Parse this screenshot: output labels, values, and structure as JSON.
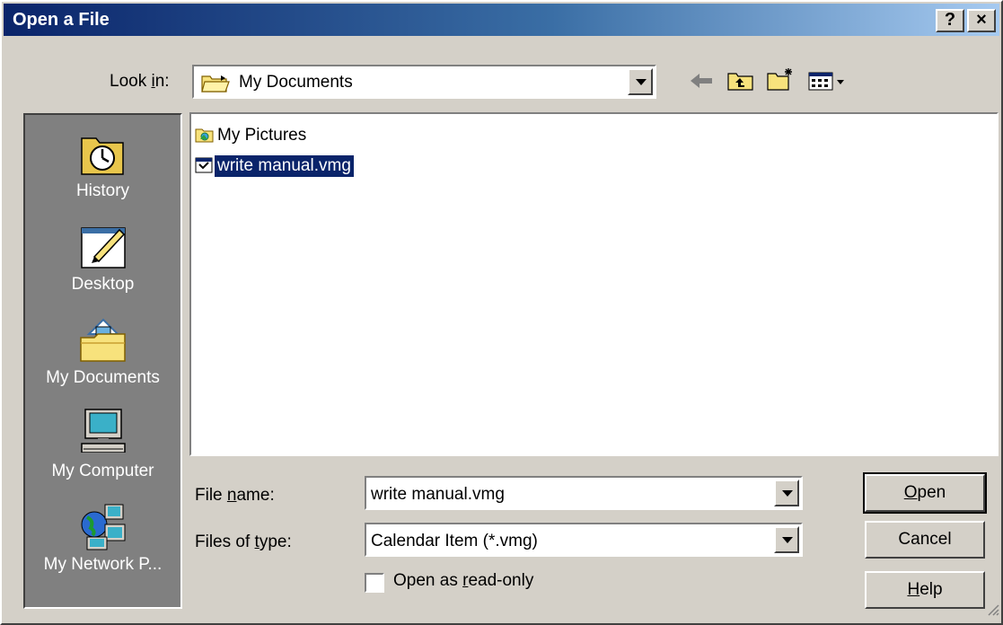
{
  "window": {
    "title": "Open a File",
    "help_btn": "?",
    "close_btn": "×"
  },
  "lookin": {
    "label_pre": "Look ",
    "label_u": "i",
    "label_post": "n:",
    "value": "My Documents"
  },
  "places": [
    {
      "label": "History",
      "icon": "history-icon"
    },
    {
      "label": "Desktop",
      "icon": "desktop-icon"
    },
    {
      "label": "My Documents",
      "icon": "my-documents-icon"
    },
    {
      "label": "My Computer",
      "icon": "my-computer-icon"
    },
    {
      "label": "My Network P...",
      "icon": "network-places-icon"
    }
  ],
  "files": [
    {
      "name": "My Pictures",
      "icon": "picture-folder-icon",
      "selected": false
    },
    {
      "name": "write manual.vmg",
      "icon": "vmg-file-icon",
      "selected": true
    }
  ],
  "filename": {
    "label_pre": "File ",
    "label_u": "n",
    "label_post": "ame:",
    "value": "write manual.vmg"
  },
  "filetype": {
    "label_pre": "Files of ",
    "label_u": "t",
    "label_post": "ype:",
    "value": "Calendar Item (*.vmg)"
  },
  "readonly": {
    "label_pre": "Open as ",
    "label_u": "r",
    "label_post": "ead-only",
    "checked": false
  },
  "buttons": {
    "open_u": "O",
    "open_rest": "pen",
    "cancel": "Cancel",
    "help_u": "H",
    "help_rest": "elp"
  }
}
